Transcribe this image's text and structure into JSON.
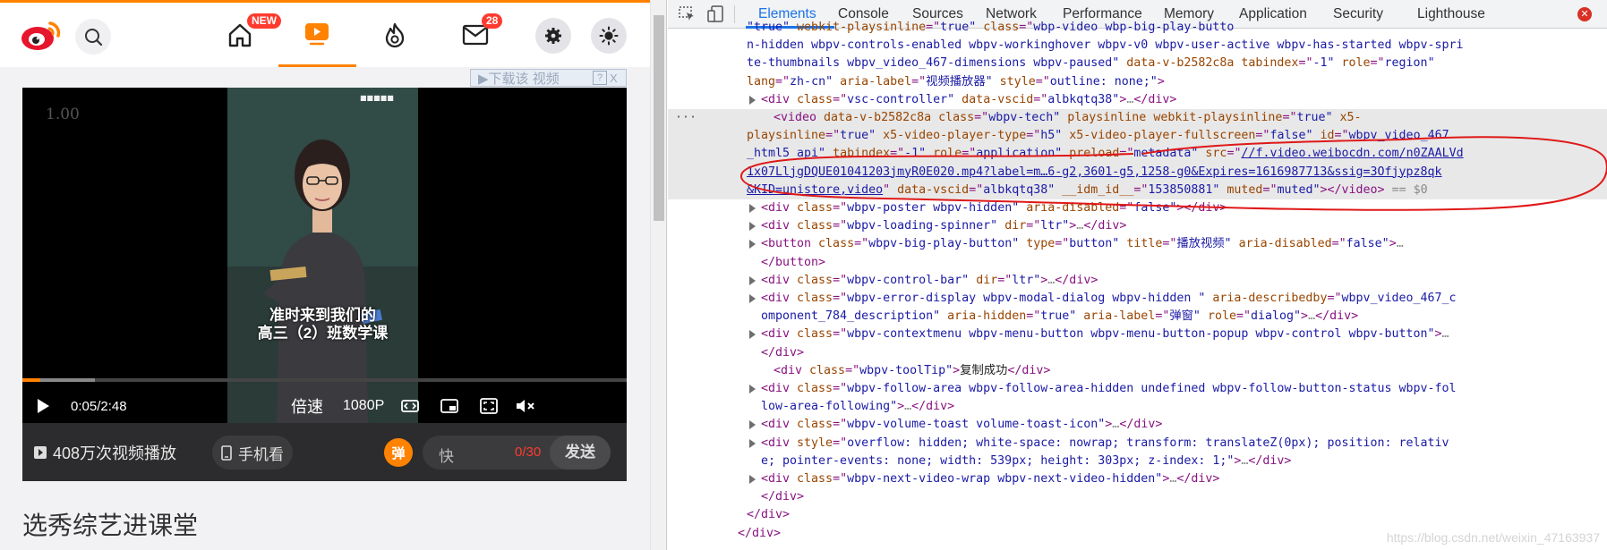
{
  "weibo": {
    "nav": {
      "home_badge": "NEW",
      "mail_badge": "28"
    },
    "download_bar": {
      "label": "▶下载该 视频",
      "help": "?",
      "close": "X"
    },
    "video": {
      "rate": "1.00",
      "channel_logo": "■■■■■",
      "subtitle_line1": "准时来到我们的",
      "subtitle_line2": "高三（2）班数学课",
      "progress": 0.03,
      "buffered": 0.12,
      "time": "0:05/2:48",
      "speed_label": "倍速",
      "quality_label": "1080P"
    },
    "danmaku_bar": {
      "play_count": "408万次视频播放",
      "phone_label": "手机看",
      "dm_icon_label": "弹",
      "input_placeholder": "快",
      "counter": "0/30",
      "send_label": "发送"
    },
    "heading": "选秀综艺进课堂"
  },
  "devtools": {
    "tabs": [
      "Elements",
      "Console",
      "Sources",
      "Network",
      "Performance",
      "Memory",
      "Application",
      "Security",
      "Lighthouse"
    ],
    "active_tab": "Elements",
    "lines": [
      {
        "text": "\"true\" webkit-playsinline=\"true\" class=\"wbp-video wbp-big-play-butto",
        "parts": [
          [
            "av",
            "\"true\" "
          ],
          [
            "an",
            "webkit-playsinline"
          ],
          [
            "tg",
            "=\""
          ],
          [
            "av",
            "true\" "
          ],
          [
            "an",
            "class"
          ],
          [
            "tg",
            "=\""
          ],
          [
            "av",
            "wbp-video wbp-big-play-butto"
          ]
        ]
      },
      {
        "parts": [
          [
            "av",
            "n-hidden wbpv-controls-enabled wbpv-workinghover wbpv-v0 wbpv-user-active wbpv-has-started wbpv-spri"
          ]
        ]
      },
      {
        "parts": [
          [
            "av",
            "te-thumbnails wbpv_video_467-dimensions wbpv-paused\" "
          ],
          [
            "an",
            "data-v-b2582c8a "
          ],
          [
            "an",
            "tabindex"
          ],
          [
            "tg",
            "=\""
          ],
          [
            "av",
            "-1\" "
          ],
          [
            "an",
            "role"
          ],
          [
            "tg",
            "=\""
          ],
          [
            "av",
            "region\""
          ]
        ]
      },
      {
        "parts": [
          [
            "an",
            "lang"
          ],
          [
            "tg",
            "=\""
          ],
          [
            "av",
            "zh-cn\" "
          ],
          [
            "an",
            "aria-label"
          ],
          [
            "tg",
            "=\""
          ],
          [
            "av",
            "视频播放器\" "
          ],
          [
            "an",
            "style"
          ],
          [
            "tg",
            "=\""
          ],
          [
            "av",
            "outline: none;\""
          ],
          [
            "tg",
            ">"
          ]
        ]
      },
      {
        "parts": [
          [
            "tg",
            "<div "
          ],
          [
            "an",
            "class"
          ],
          [
            "tg",
            "=\""
          ],
          [
            "av",
            "vsc-controller\" "
          ],
          [
            "an",
            "data-vscid"
          ],
          [
            "tg",
            "=\""
          ],
          [
            "av",
            "albkqtq38\""
          ],
          [
            "tg",
            ">"
          ],
          [
            "gr",
            "…"
          ],
          [
            "tg",
            "</div>"
          ]
        ]
      },
      {
        "parts": [
          [
            "tg",
            "<video "
          ],
          [
            "an",
            "data-v-b2582c8a "
          ],
          [
            "an",
            "class"
          ],
          [
            "tg",
            "=\""
          ],
          [
            "av",
            "wbpv-tech\" "
          ],
          [
            "an",
            "playsinline "
          ],
          [
            "an",
            "webkit-playsinline"
          ],
          [
            "tg",
            "=\""
          ],
          [
            "av",
            "true\" "
          ],
          [
            "an",
            "x5-"
          ]
        ]
      },
      {
        "parts": [
          [
            "an",
            "playsinline"
          ],
          [
            "tg",
            "=\""
          ],
          [
            "av",
            "true\" "
          ],
          [
            "an",
            "x5-video-player-type"
          ],
          [
            "tg",
            "=\""
          ],
          [
            "av",
            "h5\" "
          ],
          [
            "an",
            "x5-video-player-fullscreen"
          ],
          [
            "tg",
            "=\""
          ],
          [
            "av",
            "false\" "
          ],
          [
            "an",
            "id"
          ],
          [
            "tg",
            "=\""
          ],
          [
            "av",
            "wbpv_video_467"
          ]
        ]
      },
      {
        "parts": [
          [
            "av",
            "_html5_api\" "
          ],
          [
            "an",
            "tabindex"
          ],
          [
            "tg",
            "=\""
          ],
          [
            "av",
            "-1\" "
          ],
          [
            "an",
            "role"
          ],
          [
            "tg",
            "=\""
          ],
          [
            "av",
            "application\" "
          ],
          [
            "an",
            "preload"
          ],
          [
            "tg",
            "=\""
          ],
          [
            "av",
            "metadata\" "
          ],
          [
            "an",
            "src"
          ],
          [
            "tg",
            "=\""
          ],
          [
            "lk",
            "//f.video.weibocdn.com/n0ZAALVd"
          ]
        ]
      },
      {
        "parts": [
          [
            "lk",
            "1x07LljgDQUE01041203jmyR0E020.mp4?label=m…6-g2,3601-g5,1258-g0&Expires=1616987713&ssig=3Ofjypz8qk"
          ]
        ]
      },
      {
        "parts": [
          [
            "lk",
            "&KID=unistore,video"
          ],
          [
            "tg",
            "\" "
          ],
          [
            "an",
            "data-vscid"
          ],
          [
            "tg",
            "=\""
          ],
          [
            "av",
            "albkqtq38\" "
          ],
          [
            "an",
            "__idm_id__"
          ],
          [
            "tg",
            "=\""
          ],
          [
            "av",
            "153850881\" "
          ],
          [
            "an",
            "muted"
          ],
          [
            "tg",
            "=\""
          ],
          [
            "av",
            "muted\""
          ],
          [
            "tg",
            "></video>"
          ],
          [
            "gr",
            " == $0"
          ]
        ]
      },
      {
        "parts": [
          [
            "tg",
            "<div "
          ],
          [
            "an",
            "class"
          ],
          [
            "tg",
            "=\""
          ],
          [
            "av",
            "wbpv-poster wbpv-hidden\" "
          ],
          [
            "an",
            "aria-disabled"
          ],
          [
            "tg",
            "=\""
          ],
          [
            "av",
            "false\""
          ],
          [
            "tg",
            "></div>"
          ]
        ]
      },
      {
        "parts": [
          [
            "tg",
            "<div "
          ],
          [
            "an",
            "class"
          ],
          [
            "tg",
            "=\""
          ],
          [
            "av",
            "wbpv-loading-spinner\" "
          ],
          [
            "an",
            "dir"
          ],
          [
            "tg",
            "=\""
          ],
          [
            "av",
            "ltr\""
          ],
          [
            "tg",
            ">"
          ],
          [
            "gr",
            "…"
          ],
          [
            "tg",
            "</div>"
          ]
        ]
      },
      {
        "parts": [
          [
            "tg",
            "<button "
          ],
          [
            "an",
            "class"
          ],
          [
            "tg",
            "=\""
          ],
          [
            "av",
            "wbpv-big-play-button\" "
          ],
          [
            "an",
            "type"
          ],
          [
            "tg",
            "=\""
          ],
          [
            "av",
            "button\" "
          ],
          [
            "an",
            "title"
          ],
          [
            "tg",
            "=\""
          ],
          [
            "av",
            "播放视频\" "
          ],
          [
            "an",
            "aria-disabled"
          ],
          [
            "tg",
            "=\""
          ],
          [
            "av",
            "false\""
          ],
          [
            "tg",
            ">"
          ],
          [
            "gr",
            "…"
          ]
        ]
      },
      {
        "parts": [
          [
            "tg",
            "</button>"
          ]
        ]
      },
      {
        "parts": [
          [
            "tg",
            "<div "
          ],
          [
            "an",
            "class"
          ],
          [
            "tg",
            "=\""
          ],
          [
            "av",
            "wbpv-control-bar\" "
          ],
          [
            "an",
            "dir"
          ],
          [
            "tg",
            "=\""
          ],
          [
            "av",
            "ltr\""
          ],
          [
            "tg",
            ">"
          ],
          [
            "gr",
            "…"
          ],
          [
            "tg",
            "</div>"
          ]
        ]
      },
      {
        "parts": [
          [
            "tg",
            "<div "
          ],
          [
            "an",
            "class"
          ],
          [
            "tg",
            "=\""
          ],
          [
            "av",
            "wbpv-error-display wbpv-modal-dialog wbpv-hidden \" "
          ],
          [
            "an",
            "aria-describedby"
          ],
          [
            "tg",
            "=\""
          ],
          [
            "av",
            "wbpv_video_467_c"
          ]
        ]
      },
      {
        "parts": [
          [
            "av",
            "omponent_784_description\" "
          ],
          [
            "an",
            "aria-hidden"
          ],
          [
            "tg",
            "=\""
          ],
          [
            "av",
            "true\" "
          ],
          [
            "an",
            "aria-label"
          ],
          [
            "tg",
            "=\""
          ],
          [
            "av",
            "弹窗\" "
          ],
          [
            "an",
            "role"
          ],
          [
            "tg",
            "=\""
          ],
          [
            "av",
            "dialog\""
          ],
          [
            "tg",
            ">"
          ],
          [
            "gr",
            "…"
          ],
          [
            "tg",
            "</div>"
          ]
        ]
      },
      {
        "parts": [
          [
            "tg",
            "<div "
          ],
          [
            "an",
            "class"
          ],
          [
            "tg",
            "=\""
          ],
          [
            "av",
            "wbpv-contextmenu wbpv-menu-button wbpv-menu-button-popup wbpv-control wbpv-button\""
          ],
          [
            "tg",
            ">"
          ],
          [
            "gr",
            "…"
          ]
        ]
      },
      {
        "parts": [
          [
            "tg",
            "</div>"
          ]
        ]
      },
      {
        "parts": [
          [
            "tg",
            "<div "
          ],
          [
            "an",
            "class"
          ],
          [
            "tg",
            "=\""
          ],
          [
            "av",
            "wbpv-toolTip\""
          ],
          [
            "tg",
            ">"
          ],
          [
            "tx",
            "复制成功"
          ],
          [
            "tg",
            "</div>"
          ]
        ]
      },
      {
        "parts": [
          [
            "tg",
            "<div "
          ],
          [
            "an",
            "class"
          ],
          [
            "tg",
            "=\""
          ],
          [
            "av",
            "wbpv-follow-area wbpv-follow-area-hidden undefined wbpv-follow-button-status wbpv-fol"
          ]
        ]
      },
      {
        "parts": [
          [
            "av",
            "low-area-following\""
          ],
          [
            "tg",
            ">"
          ],
          [
            "gr",
            "…"
          ],
          [
            "tg",
            "</div>"
          ]
        ]
      },
      {
        "parts": [
          [
            "tg",
            "<div "
          ],
          [
            "an",
            "class"
          ],
          [
            "tg",
            "=\""
          ],
          [
            "av",
            "wbpv-volume-toast volume-toast-icon\""
          ],
          [
            "tg",
            ">"
          ],
          [
            "gr",
            "…"
          ],
          [
            "tg",
            "</div>"
          ]
        ]
      },
      {
        "parts": [
          [
            "tg",
            "<div "
          ],
          [
            "an",
            "style"
          ],
          [
            "tg",
            "=\""
          ],
          [
            "av",
            "overflow: hidden; white-space: nowrap; transform: translateZ(0px); position: relativ"
          ]
        ]
      },
      {
        "parts": [
          [
            "av",
            "e; pointer-events: none; width: 539px; height: 303px; z-index: 1;\""
          ],
          [
            "tg",
            ">"
          ],
          [
            "gr",
            "…"
          ],
          [
            "tg",
            "</div>"
          ]
        ]
      },
      {
        "parts": [
          [
            "tg",
            "<div "
          ],
          [
            "an",
            "class"
          ],
          [
            "tg",
            "=\""
          ],
          [
            "av",
            "wbpv-next-video-wrap wbpv-next-video-hidden\""
          ],
          [
            "tg",
            ">"
          ],
          [
            "gr",
            "…"
          ],
          [
            "tg",
            "</div>"
          ]
        ]
      },
      {
        "parts": [
          [
            "tg",
            "</div>"
          ]
        ]
      },
      {
        "parts": [
          [
            "tg",
            "</div>"
          ]
        ]
      },
      {
        "parts": [
          [
            "tg",
            "</div>"
          ]
        ]
      }
    ],
    "watermark": "https://blog.csdn.net/weixin_47163937",
    "ellipsis": "···"
  }
}
